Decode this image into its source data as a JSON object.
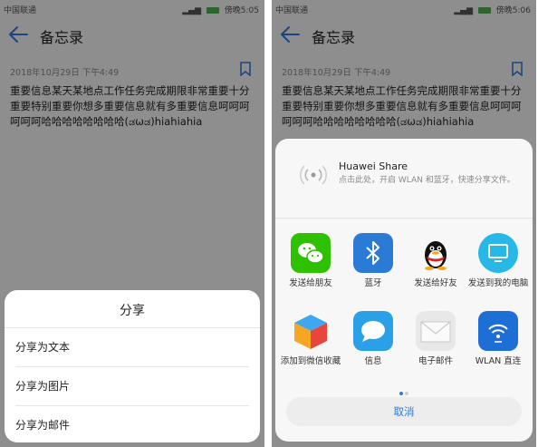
{
  "left": {
    "status": {
      "carrier": "中国联通",
      "time_prefix": "傍晚",
      "time": "5:05"
    },
    "app_title": "备忘录",
    "date": "2018年10月29日 下午4:49",
    "note_text": "重要信息某天某地点工作任务完成期限非常重要十分重要特别重要你想多重要信息就有多重要信息呵呵呵呵呵呵哈哈哈哈哈哈哈哈(ಡωಡ)hiahiahia",
    "share": {
      "title": "分享",
      "options": [
        "分享为文本",
        "分享为图片",
        "分享为邮件"
      ]
    }
  },
  "right": {
    "status": {
      "carrier": "中国联通",
      "time_prefix": "傍晚",
      "time": "5:06"
    },
    "app_title": "备忘录",
    "date": "2018年10月29日 下午4:49",
    "note_text": "重要信息某天某地点工作任务完成期限非常重要十分重要特别重要你想多重要信息就有多重要信息呵呵呵呵呵呵哈哈哈哈哈哈哈哈(ಡωಡ)hiahiahia",
    "huawei_share": {
      "title": "Huawei Share",
      "subtitle": "点击此处，开启 WLAN 和蓝牙，快速分享文件。"
    },
    "apps": [
      {
        "label": "发送给朋友",
        "icon": "wechat-icon"
      },
      {
        "label": "蓝牙",
        "icon": "bluetooth-icon"
      },
      {
        "label": "发送给好友",
        "icon": "qq-icon"
      },
      {
        "label": "发送到我的电脑",
        "icon": "computer-icon"
      },
      {
        "label": "添加到微信收藏",
        "icon": "wechat-favorites-icon"
      },
      {
        "label": "信息",
        "icon": "messages-icon"
      },
      {
        "label": "电子邮件",
        "icon": "email-icon"
      },
      {
        "label": "WLAN 直连",
        "icon": "wifi-direct-icon"
      }
    ],
    "cancel_label": "取消"
  },
  "colors": {
    "accent": "#2f7bd9",
    "wechat": "#2dc100",
    "bluetooth": "#2b7bd6",
    "wlan": "#1d6fd6"
  }
}
